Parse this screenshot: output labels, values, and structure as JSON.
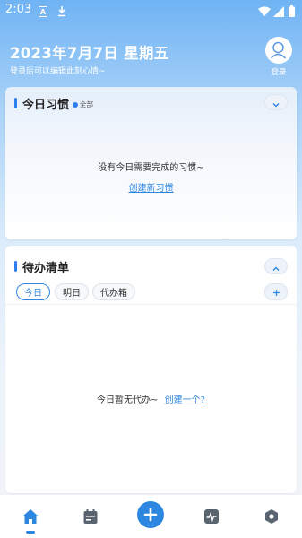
{
  "status_bar": {
    "time": "2:03",
    "icons": [
      "font-icon",
      "download-icon",
      "wifi-icon",
      "signal-icon",
      "battery-icon"
    ]
  },
  "header": {
    "date_title": "2023年7月7日 星期五",
    "subtitle": "登录后可以编辑此刻心情~",
    "login_label": "登录"
  },
  "habits_card": {
    "title": "今日习惯",
    "tag_label": "全部",
    "empty_text": "没有今日需要完成的习惯~",
    "create_link": "创建新习惯",
    "toggle_icon": "chevron-down-icon"
  },
  "todo_card": {
    "title": "待办清单",
    "toggle_icon": "chevron-up-icon",
    "tabs": [
      {
        "label": "今日",
        "active": true
      },
      {
        "label": "明日",
        "active": false
      },
      {
        "label": "代办箱",
        "active": false
      }
    ],
    "empty_text": "今日暂无代办~",
    "create_link": "创建一个?"
  },
  "bottom_nav": {
    "items": [
      "home-icon",
      "calendar-icon",
      "add-icon",
      "activity-icon",
      "settings-hex-icon"
    ],
    "active": "home-icon"
  },
  "colors": {
    "accent": "#2d86e0",
    "header_gradient_top": "#6fb3f4",
    "background": "#f1f4f8"
  }
}
